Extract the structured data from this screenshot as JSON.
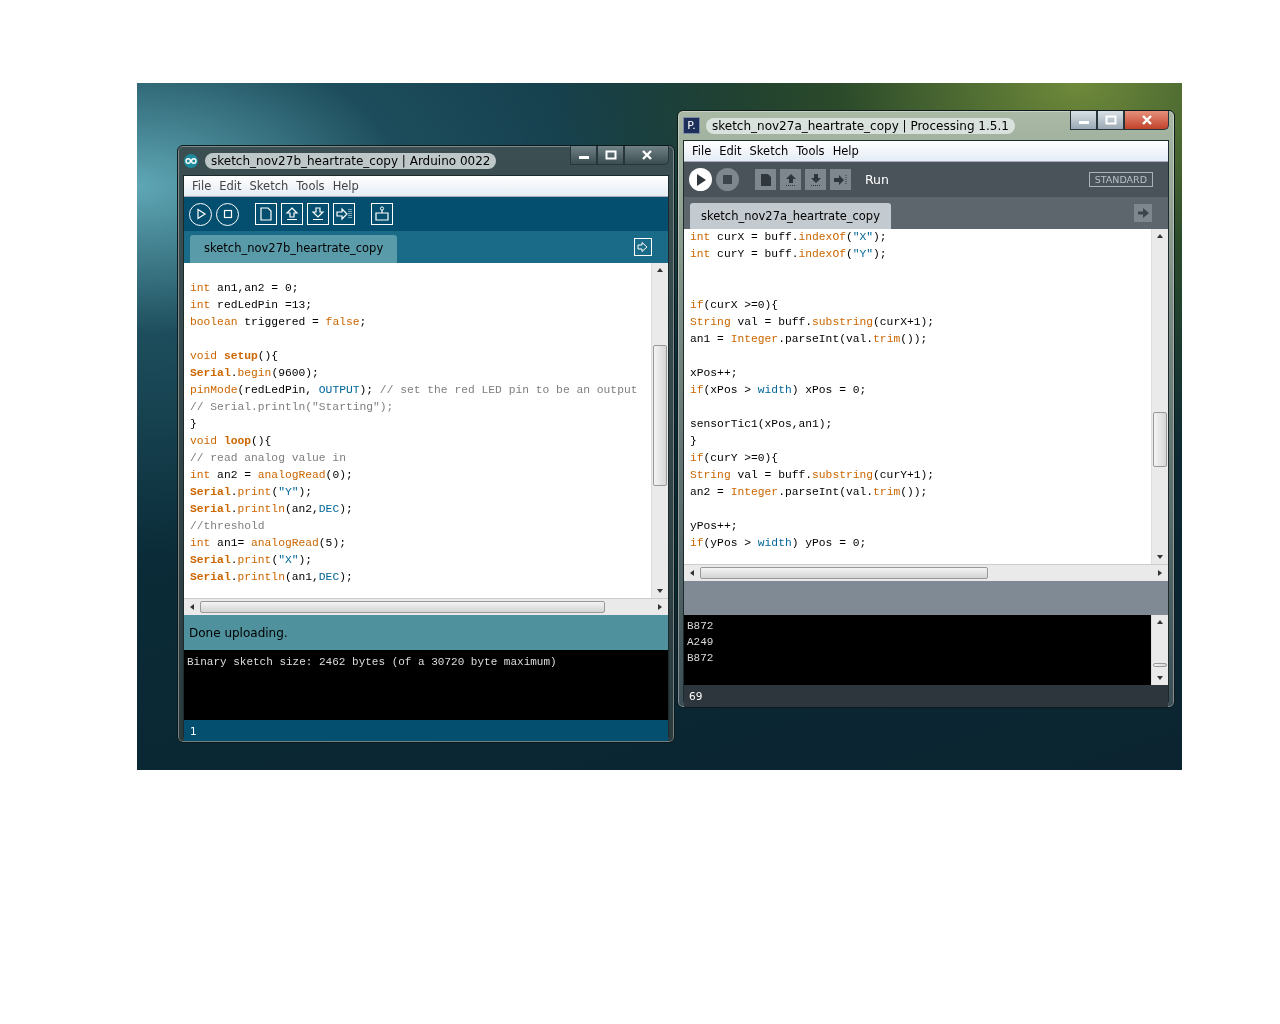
{
  "arduino_window": {
    "title": "sketch_nov27b_heartrate_copy | Arduino 0022",
    "active": false,
    "menu": [
      "File",
      "Edit",
      "Sketch",
      "Tools",
      "Help"
    ],
    "tab": {
      "label": "sketch_nov27b_heartrate_copy"
    },
    "code": [
      {
        "kind": "blank"
      },
      {
        "kind": "code",
        "tokens": [
          {
            "kind": "keyword",
            "text": "int"
          },
          {
            "kind": "plain",
            "text": " an1,an2 = 0;"
          }
        ]
      },
      {
        "kind": "code",
        "tokens": [
          {
            "kind": "keyword",
            "text": "int"
          },
          {
            "kind": "plain",
            "text": " redLedPin =13;"
          }
        ]
      },
      {
        "kind": "code",
        "tokens": [
          {
            "kind": "keyword",
            "text": "boolean"
          },
          {
            "kind": "plain",
            "text": " triggered = "
          },
          {
            "kind": "keyword",
            "text": "false"
          },
          {
            "kind": "plain",
            "text": ";"
          }
        ]
      },
      {
        "kind": "blank"
      },
      {
        "kind": "code",
        "tokens": [
          {
            "kind": "keyword",
            "text": "void "
          },
          {
            "kind": "bold",
            "text": "setup"
          },
          {
            "kind": "plain",
            "text": "(){"
          }
        ]
      },
      {
        "kind": "code",
        "tokens": [
          {
            "kind": "bold",
            "text": "Serial"
          },
          {
            "kind": "plain",
            "text": "."
          },
          {
            "kind": "keyword",
            "text": "begin"
          },
          {
            "kind": "plain",
            "text": "(9600);"
          }
        ]
      },
      {
        "kind": "code",
        "tokens": [
          {
            "kind": "keyword",
            "text": "pinMode"
          },
          {
            "kind": "plain",
            "text": "(redLedPin, "
          },
          {
            "kind": "constant",
            "text": "OUTPUT"
          },
          {
            "kind": "plain",
            "text": "); "
          },
          {
            "kind": "comment",
            "text": "// set the red LED pin to be an output"
          }
        ]
      },
      {
        "kind": "code",
        "tokens": [
          {
            "kind": "comment",
            "text": "// Serial.println(\"Starting\");"
          }
        ]
      },
      {
        "kind": "code",
        "tokens": [
          {
            "kind": "plain",
            "text": "}"
          }
        ]
      },
      {
        "kind": "code",
        "tokens": [
          {
            "kind": "keyword",
            "text": "void "
          },
          {
            "kind": "bold",
            "text": "loop"
          },
          {
            "kind": "plain",
            "text": "(){"
          }
        ]
      },
      {
        "kind": "code",
        "tokens": [
          {
            "kind": "comment",
            "text": "// read analog value in"
          }
        ]
      },
      {
        "kind": "code",
        "tokens": [
          {
            "kind": "keyword",
            "text": "int"
          },
          {
            "kind": "plain",
            "text": " an2 = "
          },
          {
            "kind": "keyword",
            "text": "analogRead"
          },
          {
            "kind": "plain",
            "text": "(0);"
          }
        ]
      },
      {
        "kind": "code",
        "tokens": [
          {
            "kind": "bold",
            "text": "Serial"
          },
          {
            "kind": "plain",
            "text": "."
          },
          {
            "kind": "keyword",
            "text": "print"
          },
          {
            "kind": "plain",
            "text": "("
          },
          {
            "kind": "constant",
            "text": "\"Y\""
          },
          {
            "kind": "plain",
            "text": ");"
          }
        ]
      },
      {
        "kind": "code",
        "tokens": [
          {
            "kind": "bold",
            "text": "Serial"
          },
          {
            "kind": "plain",
            "text": "."
          },
          {
            "kind": "keyword",
            "text": "println"
          },
          {
            "kind": "plain",
            "text": "(an2,"
          },
          {
            "kind": "constant",
            "text": "DEC"
          },
          {
            "kind": "plain",
            "text": ");"
          }
        ]
      },
      {
        "kind": "code",
        "tokens": [
          {
            "kind": "comment",
            "text": "//threshold"
          }
        ]
      },
      {
        "kind": "code",
        "tokens": [
          {
            "kind": "keyword",
            "text": "int"
          },
          {
            "kind": "plain",
            "text": " an1= "
          },
          {
            "kind": "keyword",
            "text": "analogRead"
          },
          {
            "kind": "plain",
            "text": "(5);"
          }
        ]
      },
      {
        "kind": "code",
        "tokens": [
          {
            "kind": "bold",
            "text": "Serial"
          },
          {
            "kind": "plain",
            "text": "."
          },
          {
            "kind": "keyword",
            "text": "print"
          },
          {
            "kind": "plain",
            "text": "("
          },
          {
            "kind": "constant",
            "text": "\"X\""
          },
          {
            "kind": "plain",
            "text": ");"
          }
        ]
      },
      {
        "kind": "code",
        "tokens": [
          {
            "kind": "bold",
            "text": "Serial"
          },
          {
            "kind": "plain",
            "text": "."
          },
          {
            "kind": "keyword",
            "text": "println"
          },
          {
            "kind": "plain",
            "text": "(an1,"
          },
          {
            "kind": "constant",
            "text": "DEC"
          },
          {
            "kind": "plain",
            "text": ");"
          }
        ]
      }
    ],
    "status": "Done uploading.",
    "console": [
      "Binary sketch size: 2462 bytes (of a 30720 byte maximum)"
    ],
    "line_number": "1"
  },
  "processing_window": {
    "title": "sketch_nov27a_heartrate_copy | Processing 1.5.1",
    "active": true,
    "app_icon_text": "P.",
    "menu": [
      "File",
      "Edit",
      "Sketch",
      "Tools",
      "Help"
    ],
    "toolbar_label": "Run",
    "mode_button": "STANDARD",
    "tab": {
      "label": "sketch_nov27a_heartrate_copy"
    },
    "code": [
      {
        "kind": "code",
        "tokens": [
          {
            "kind": "keyword",
            "text": "int"
          },
          {
            "kind": "plain",
            "text": " curX = buff."
          },
          {
            "kind": "keyword",
            "text": "indexOf"
          },
          {
            "kind": "plain",
            "text": "("
          },
          {
            "kind": "constant",
            "text": "\"X\""
          },
          {
            "kind": "plain",
            "text": ");"
          }
        ]
      },
      {
        "kind": "code",
        "tokens": [
          {
            "kind": "keyword",
            "text": "int"
          },
          {
            "kind": "plain",
            "text": " curY = buff."
          },
          {
            "kind": "keyword",
            "text": "indexOf"
          },
          {
            "kind": "plain",
            "text": "("
          },
          {
            "kind": "constant",
            "text": "\"Y\""
          },
          {
            "kind": "plain",
            "text": ");"
          }
        ]
      },
      {
        "kind": "blank"
      },
      {
        "kind": "blank"
      },
      {
        "kind": "code",
        "tokens": [
          {
            "kind": "keyword",
            "text": "if"
          },
          {
            "kind": "plain",
            "text": "(curX >=0){"
          }
        ]
      },
      {
        "kind": "code",
        "tokens": [
          {
            "kind": "keyword",
            "text": "String"
          },
          {
            "kind": "plain",
            "text": " val = buff."
          },
          {
            "kind": "keyword",
            "text": "substring"
          },
          {
            "kind": "plain",
            "text": "(curX+1);"
          }
        ]
      },
      {
        "kind": "code",
        "tokens": [
          {
            "kind": "plain",
            "text": "an1 = "
          },
          {
            "kind": "keyword",
            "text": "Integer"
          },
          {
            "kind": "plain",
            "text": ".parseInt(val."
          },
          {
            "kind": "keyword",
            "text": "trim"
          },
          {
            "kind": "plain",
            "text": "());"
          }
        ]
      },
      {
        "kind": "blank"
      },
      {
        "kind": "code",
        "tokens": [
          {
            "kind": "plain",
            "text": "xPos++;"
          }
        ]
      },
      {
        "kind": "code",
        "tokens": [
          {
            "kind": "keyword",
            "text": "if"
          },
          {
            "kind": "plain",
            "text": "(xPos > "
          },
          {
            "kind": "constant",
            "text": "width"
          },
          {
            "kind": "plain",
            "text": ") xPos = 0;"
          }
        ]
      },
      {
        "kind": "blank"
      },
      {
        "kind": "code",
        "tokens": [
          {
            "kind": "plain",
            "text": "sensorTic1(xPos,an1);"
          }
        ]
      },
      {
        "kind": "code",
        "tokens": [
          {
            "kind": "plain",
            "text": "}"
          }
        ]
      },
      {
        "kind": "code",
        "tokens": [
          {
            "kind": "keyword",
            "text": "if"
          },
          {
            "kind": "plain",
            "text": "(curY >=0){"
          }
        ]
      },
      {
        "kind": "code",
        "tokens": [
          {
            "kind": "keyword",
            "text": "String"
          },
          {
            "kind": "plain",
            "text": " val = buff."
          },
          {
            "kind": "keyword",
            "text": "substring"
          },
          {
            "kind": "plain",
            "text": "(curY+1);"
          }
        ]
      },
      {
        "kind": "code",
        "tokens": [
          {
            "kind": "plain",
            "text": "an2 = "
          },
          {
            "kind": "keyword",
            "text": "Integer"
          },
          {
            "kind": "plain",
            "text": ".parseInt(val."
          },
          {
            "kind": "keyword",
            "text": "trim"
          },
          {
            "kind": "plain",
            "text": "());"
          }
        ]
      },
      {
        "kind": "blank"
      },
      {
        "kind": "code",
        "tokens": [
          {
            "kind": "plain",
            "text": "yPos++;"
          }
        ]
      },
      {
        "kind": "code",
        "tokens": [
          {
            "kind": "keyword",
            "text": "if"
          },
          {
            "kind": "plain",
            "text": "(yPos > "
          },
          {
            "kind": "constant",
            "text": "width"
          },
          {
            "kind": "plain",
            "text": ") yPos = 0;"
          }
        ]
      }
    ],
    "console": [
      "B872",
      "A249",
      "B872"
    ],
    "line_number": "69"
  }
}
